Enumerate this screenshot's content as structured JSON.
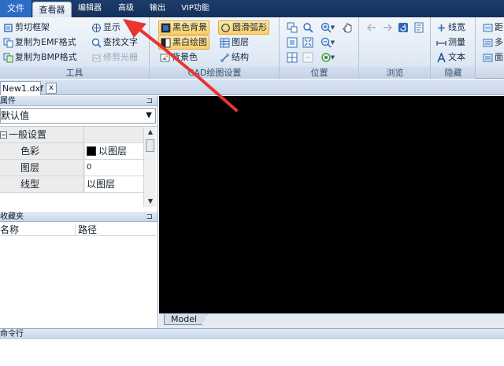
{
  "menu": {
    "file": "文件",
    "viewer": "查看器",
    "editor": "编辑器",
    "advanced": "高级",
    "output": "输出",
    "vip": "VIP功能"
  },
  "ribbon": {
    "tools": {
      "label": "工具",
      "crop_frame": "剪切框架",
      "copy_emf": "复制为EMF格式",
      "copy_bmp": "复制为BMP格式",
      "show": "显示",
      "find_text": "查找文字",
      "trim_light": "修剪光栅"
    },
    "cad_settings": {
      "label": "CAD绘图设置",
      "black_bg": "黑色背景",
      "bw_drawing": "黑白绘图",
      "bg_color": "背景色",
      "smooth_arc": "圆滑弧形",
      "layers": "图层",
      "structure": "结构"
    },
    "position": {
      "label": "位置"
    },
    "browse": {
      "label": "浏览"
    },
    "hide": {
      "label": "隐藏",
      "line_width": "线宽",
      "measure": "测量",
      "text": "文本"
    },
    "extra": {
      "item1": "距",
      "item2": "多",
      "item3": "面"
    }
  },
  "document": {
    "tab": "New1.dxf",
    "close": "x"
  },
  "properties": {
    "title": "属件",
    "selected": "默认值",
    "rows": [
      {
        "key": "一般设置",
        "value": ""
      },
      {
        "key": "色彩",
        "value": "以图层"
      },
      {
        "key": "图层",
        "value": "0"
      },
      {
        "key": "线型",
        "value": "以图层"
      }
    ]
  },
  "favorites": {
    "title": "收藏夹",
    "col_name": "名称",
    "col_path": "路径"
  },
  "layout": {
    "model_tab": "Model"
  },
  "command": {
    "title": "命令行"
  },
  "colors": {
    "annotation_arrow": "#e8352e",
    "canvas_bg": "#000000",
    "active_button": "#ffcf63",
    "menu_bar": "#1c3d6b"
  }
}
